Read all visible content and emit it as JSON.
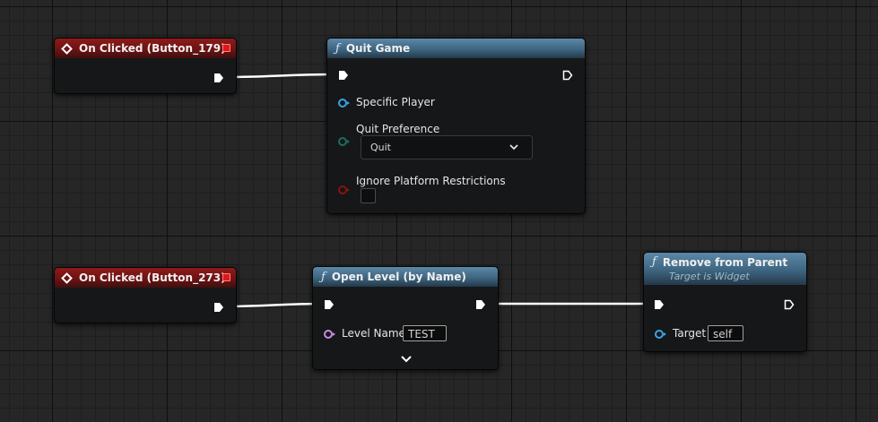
{
  "colors": {
    "event_header": "#8e1b1b",
    "function_header": "#3e6580",
    "object_pin": "#3aa4e6",
    "byte_pin": "#1f6b63",
    "bool_pin": "#8a1212",
    "name_pin": "#c78ce0",
    "exec_wire": "#ffffff"
  },
  "nodes": {
    "on_clicked_179": {
      "title": "On Clicked (Button_179)",
      "icon": "event-diamond-icon",
      "delegate_icon": "delegate-square-icon"
    },
    "quit_game": {
      "title": "Quit Game",
      "icon": "function-icon",
      "pins": {
        "specific_player": "Specific Player",
        "quit_preference": "Quit Preference",
        "quit_preference_value": "Quit",
        "ignore_platform_restrictions": "Ignore Platform Restrictions"
      }
    },
    "on_clicked_273": {
      "title": "On Clicked (Button_273)",
      "icon": "event-diamond-icon",
      "delegate_icon": "delegate-square-icon"
    },
    "open_level": {
      "title": "Open Level (by Name)",
      "icon": "function-icon",
      "pins": {
        "level_name": "Level Name",
        "level_name_value": "TEST"
      }
    },
    "remove_from_parent": {
      "title": "Remove from Parent",
      "subtitle": "Target is Widget",
      "icon": "function-icon",
      "pins": {
        "target": "Target",
        "target_value": "self"
      }
    }
  }
}
